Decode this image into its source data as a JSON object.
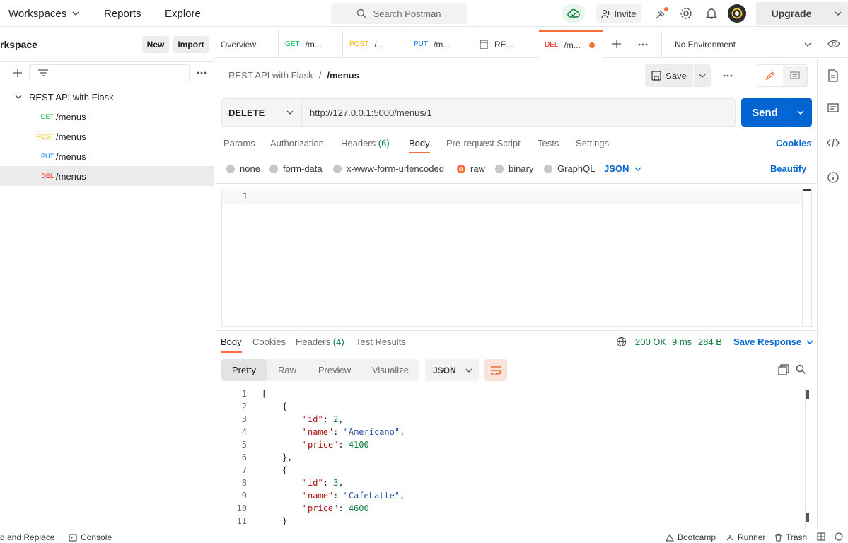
{
  "topbar": {
    "nav": [
      "Workspaces",
      "Reports",
      "Explore"
    ],
    "search_placeholder": "Search Postman",
    "invite_label": "Invite",
    "upgrade_label": "Upgrade"
  },
  "sidebar": {
    "workspace_title": "rkspace",
    "new_label": "New",
    "import_label": "Import",
    "collection_name": "REST API with Flask",
    "requests": [
      {
        "method": "GET",
        "name": "/menus",
        "color": "#0cbb52"
      },
      {
        "method": "POST",
        "name": "/menus",
        "color": "#ffb400"
      },
      {
        "method": "PUT",
        "name": "/menus",
        "color": "#097bed"
      },
      {
        "method": "DEL",
        "name": "/menus",
        "color": "#eb2013"
      }
    ]
  },
  "tabs": {
    "items": [
      {
        "method": "",
        "label": "Overview",
        "color": ""
      },
      {
        "method": "GET",
        "label": "/m...",
        "color": "#0cbb52"
      },
      {
        "method": "POST",
        "label": "/...",
        "color": "#ffb400"
      },
      {
        "method": "PUT",
        "label": "/m...",
        "color": "#097bed"
      },
      {
        "method": "",
        "label": "RE...",
        "color": ""
      },
      {
        "method": "DEL",
        "label": "/m...",
        "color": "#eb2013"
      }
    ],
    "environment": "No Environment"
  },
  "request": {
    "breadcrumb_collection": "REST API with Flask",
    "breadcrumb_separator": "/",
    "breadcrumb_request": "/menus",
    "save_label": "Save",
    "method": "DELETE",
    "url": "http://127.0.0.1:5000/menus/1",
    "send_label": "Send",
    "tabs": [
      "Params",
      "Authorization",
      "Headers",
      "Body",
      "Pre-request Script",
      "Tests",
      "Settings"
    ],
    "headers_count": "(6)",
    "cookies_label": "Cookies",
    "body_modes": [
      "none",
      "form-data",
      "x-www-form-urlencoded",
      "raw",
      "binary",
      "GraphQL"
    ],
    "body_format": "JSON",
    "beautify_label": "Beautify",
    "editor_line": "1"
  },
  "response": {
    "tabs": [
      "Body",
      "Cookies",
      "Headers",
      "Test Results"
    ],
    "headers_count": "(4)",
    "status": "200 OK",
    "time": "9 ms",
    "size": "284 B",
    "save_response_label": "Save Response",
    "views": [
      "Pretty",
      "Raw",
      "Preview",
      "Visualize"
    ],
    "format": "JSON",
    "lines": [
      {
        "n": "1",
        "t": "["
      },
      {
        "n": "2",
        "t": "    {"
      },
      {
        "n": "3",
        "key": "\"id\"",
        "val": "2",
        "type": "num"
      },
      {
        "n": "4",
        "key": "\"name\"",
        "val": "\"Americano\"",
        "type": "str"
      },
      {
        "n": "5",
        "key": "\"price\"",
        "val": "4100",
        "type": "num",
        "last": true
      },
      {
        "n": "6",
        "t": "    },"
      },
      {
        "n": "7",
        "t": "    {"
      },
      {
        "n": "8",
        "key": "\"id\"",
        "val": "3",
        "type": "num"
      },
      {
        "n": "9",
        "key": "\"name\"",
        "val": "\"CafeLatte\"",
        "type": "str"
      },
      {
        "n": "10",
        "key": "\"price\"",
        "val": "4600",
        "type": "num",
        "last": true
      },
      {
        "n": "11",
        "t": "    }"
      }
    ]
  },
  "statusbar": {
    "find_replace": "d and Replace",
    "console": "Console",
    "bootcamp": "Bootcamp",
    "runner": "Runner",
    "trash": "Trash"
  }
}
